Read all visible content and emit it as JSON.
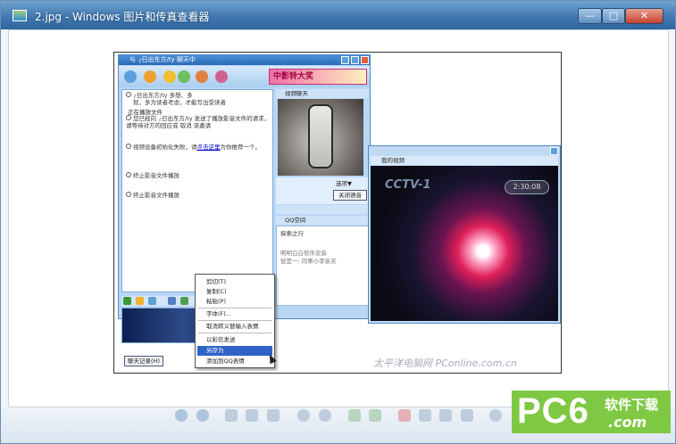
{
  "window": {
    "title": "2.jpg - Windows 图片和传真查看器",
    "min_glyph": "—",
    "max_glyph": "□",
    "close_glyph": "✕"
  },
  "qq": {
    "title": "与 ╭日出东方/ty 聊天中",
    "banner": "中影铃大奖",
    "contact_line": "╭日出东方/ty         多想、多",
    "contact_line2": "就、多为读者考虑，才能写出受读者",
    "playing": "正在播放文件",
    "msg1": "您已经向 ╭日出东方/ty 发送了播放影音文件的请求，请等待对方的回应或 取消  该邀请",
    "msg2_a": "视频设备初始化失败，请",
    "msg2_link": "点击这里",
    "msg2_b": "为你推荐一个。",
    "msg3": "终止影音文件播放",
    "msg4": "终止影音文件播放",
    "history_btn": "聊天记录(H)",
    "video_chat_head": "视频聊天",
    "options_label": "选项▼",
    "close_voice_btn": "关闭语音",
    "qzone_head": "QQ空间",
    "qzone_item": "探索之行",
    "qzone_note1": "明明白白软件安装",
    "qzone_note2": "链是一: 同事小李家买",
    "my_video_head": "我的视频",
    "clock": "2:30:08"
  },
  "menu": {
    "items": [
      "剪切(T)",
      "复制(C)",
      "粘贴(P)",
      "字体(F)...",
      "取消转义替输入表情",
      "以彩信发送",
      "另存为",
      "添加到QQ表情"
    ],
    "highlighted_index": 6
  },
  "watermark": "太平洋电脑网 PConline.com.cn",
  "logo": {
    "text": "PC6",
    "cn": "软件下载",
    "com": ".com"
  }
}
